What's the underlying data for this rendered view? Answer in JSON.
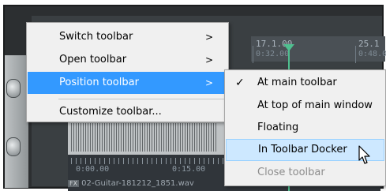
{
  "background": {
    "ruler": {
      "markers": [
        {
          "label": "17.1.00",
          "sub": "0:32.00"
        },
        {
          "label": "25.1",
          "sub": "0:48.0"
        }
      ]
    },
    "timeline": {
      "labels": [
        "0:00.00",
        "0:15.00"
      ]
    },
    "item": {
      "fx_badge": "FX",
      "filename": "02-Guitar-181212_1851.wav"
    }
  },
  "main_menu": {
    "items": [
      {
        "label": "Switch toolbar",
        "submenu_arrow": ">"
      },
      {
        "label": "Open toolbar",
        "submenu_arrow": ">"
      },
      {
        "label": "Position toolbar",
        "submenu_arrow": ">",
        "state": "highlighted"
      },
      {
        "label": "Customize toolbar..."
      }
    ]
  },
  "position_submenu": {
    "items": [
      {
        "label": "At main toolbar",
        "checked": true
      },
      {
        "label": "At top of main window"
      },
      {
        "label": "Floating"
      },
      {
        "label": "In Toolbar Docker",
        "state": "hovered"
      },
      {
        "label": "Close toolbar",
        "state": "disabled"
      }
    ],
    "check_glyph": "✓"
  },
  "colors": {
    "menu_bg": "#f0f0f0",
    "highlight": "#3399ff",
    "hover": "#cde8ff",
    "disabled_text": "#8c8c8c",
    "playhead": "#4fbf8f"
  }
}
